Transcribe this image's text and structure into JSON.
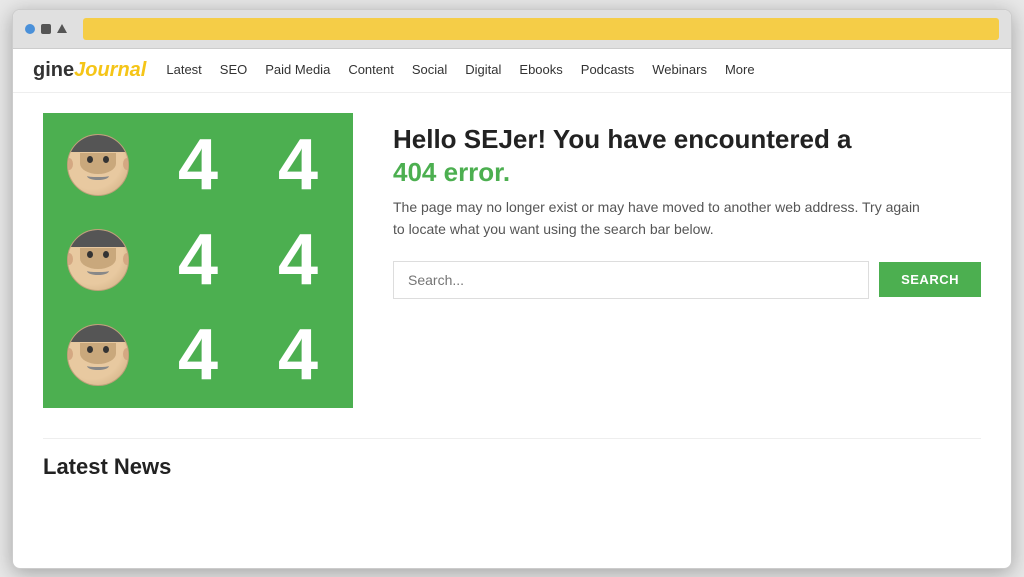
{
  "browser": {
    "address_bar_color": "#f5cd47"
  },
  "site": {
    "logo_gine": "gine",
    "logo_journal": "Journal"
  },
  "nav": {
    "links": [
      {
        "label": "Latest"
      },
      {
        "label": "SEO"
      },
      {
        "label": "Paid Media"
      },
      {
        "label": "Content"
      },
      {
        "label": "Social"
      },
      {
        "label": "Digital"
      },
      {
        "label": "Ebooks"
      },
      {
        "label": "Podcasts"
      },
      {
        "label": "Webinars"
      },
      {
        "label": "More"
      }
    ]
  },
  "error_page": {
    "headline_part1": "Hello SEJer! You have encountered a",
    "headline_part2": "404 error.",
    "description": "The page may no longer exist or may have moved to another web address. Try again to locate what you want using the search bar below.",
    "search_placeholder": "Search...",
    "search_button_label": "SEARCH"
  },
  "latest_news": {
    "title": "Latest News"
  }
}
